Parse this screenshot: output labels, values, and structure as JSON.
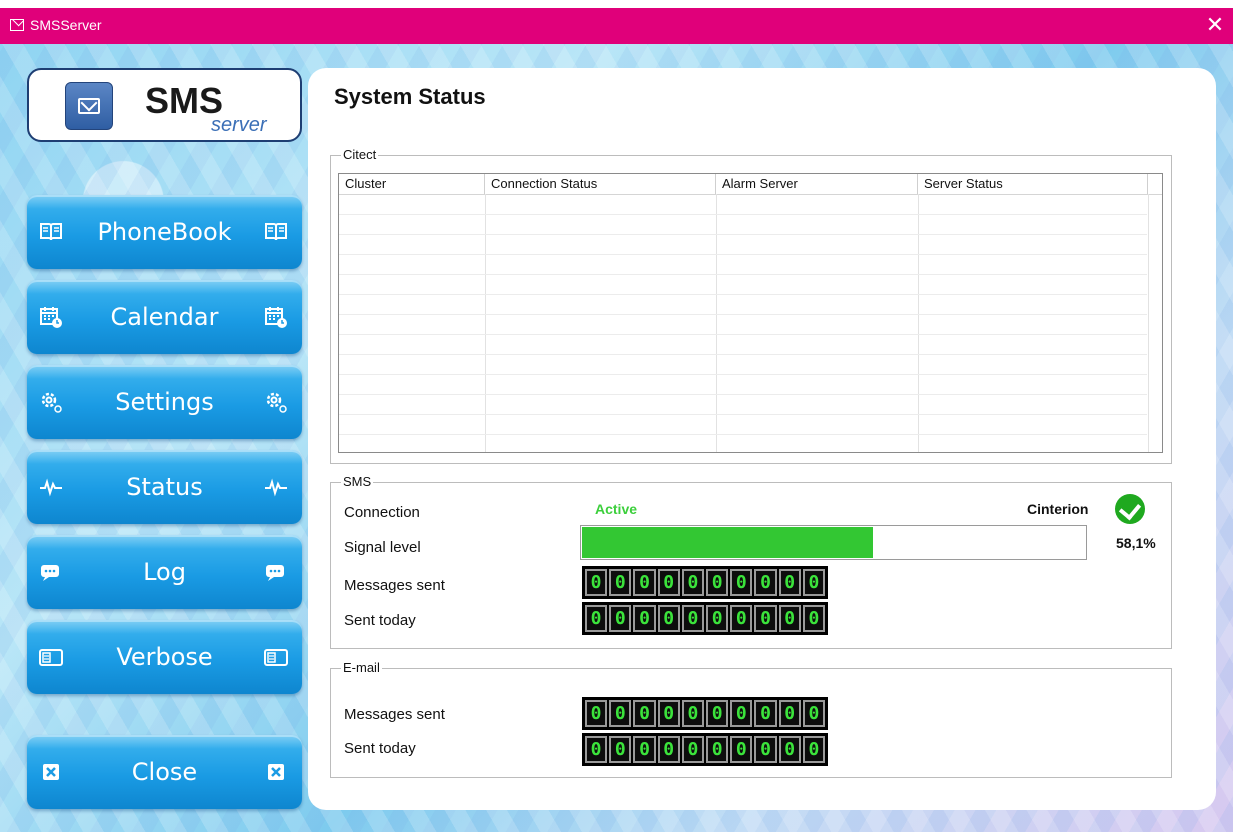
{
  "window": {
    "title": "SMSServer",
    "close_glyph": "✕"
  },
  "logo": {
    "title": "SMS",
    "subtitle": "server"
  },
  "nav": [
    {
      "label": "PhoneBook",
      "icon": "book-icon"
    },
    {
      "label": "Calendar",
      "icon": "calendar-icon"
    },
    {
      "label": "Settings",
      "icon": "gear-icon"
    },
    {
      "label": "Status",
      "icon": "pulse-icon"
    },
    {
      "label": "Log",
      "icon": "chat-icon"
    },
    {
      "label": "Verbose",
      "icon": "id-card-icon"
    }
  ],
  "close_button": {
    "label": "Close",
    "icon": "close-icon"
  },
  "page": {
    "title": "System Status"
  },
  "citect": {
    "group_label": "Citect",
    "columns": [
      "Cluster",
      "Connection Status",
      "Alarm Server",
      "Server Status"
    ],
    "rows": []
  },
  "sms": {
    "group_label": "SMS",
    "connection_label": "Connection",
    "connection_status": "Active",
    "modem_name": "Cinterion",
    "signal_label": "Signal level",
    "signal_percent_text": "58,1%",
    "signal_fraction": 0.581,
    "messages_sent_label": "Messages sent",
    "messages_sent_digits": "0000000000",
    "sent_today_label": "Sent today",
    "sent_today_digits": "0000000000"
  },
  "email": {
    "group_label": "E-mail",
    "messages_sent_label": "Messages sent",
    "messages_sent_digits": "0000000000",
    "sent_today_label": "Sent today",
    "sent_today_digits": "0000000000"
  },
  "colors": {
    "titlebar": "#e0007a",
    "button": "#1a9be4",
    "active": "#3ccf3c",
    "signal_fill": "#33c733"
  }
}
